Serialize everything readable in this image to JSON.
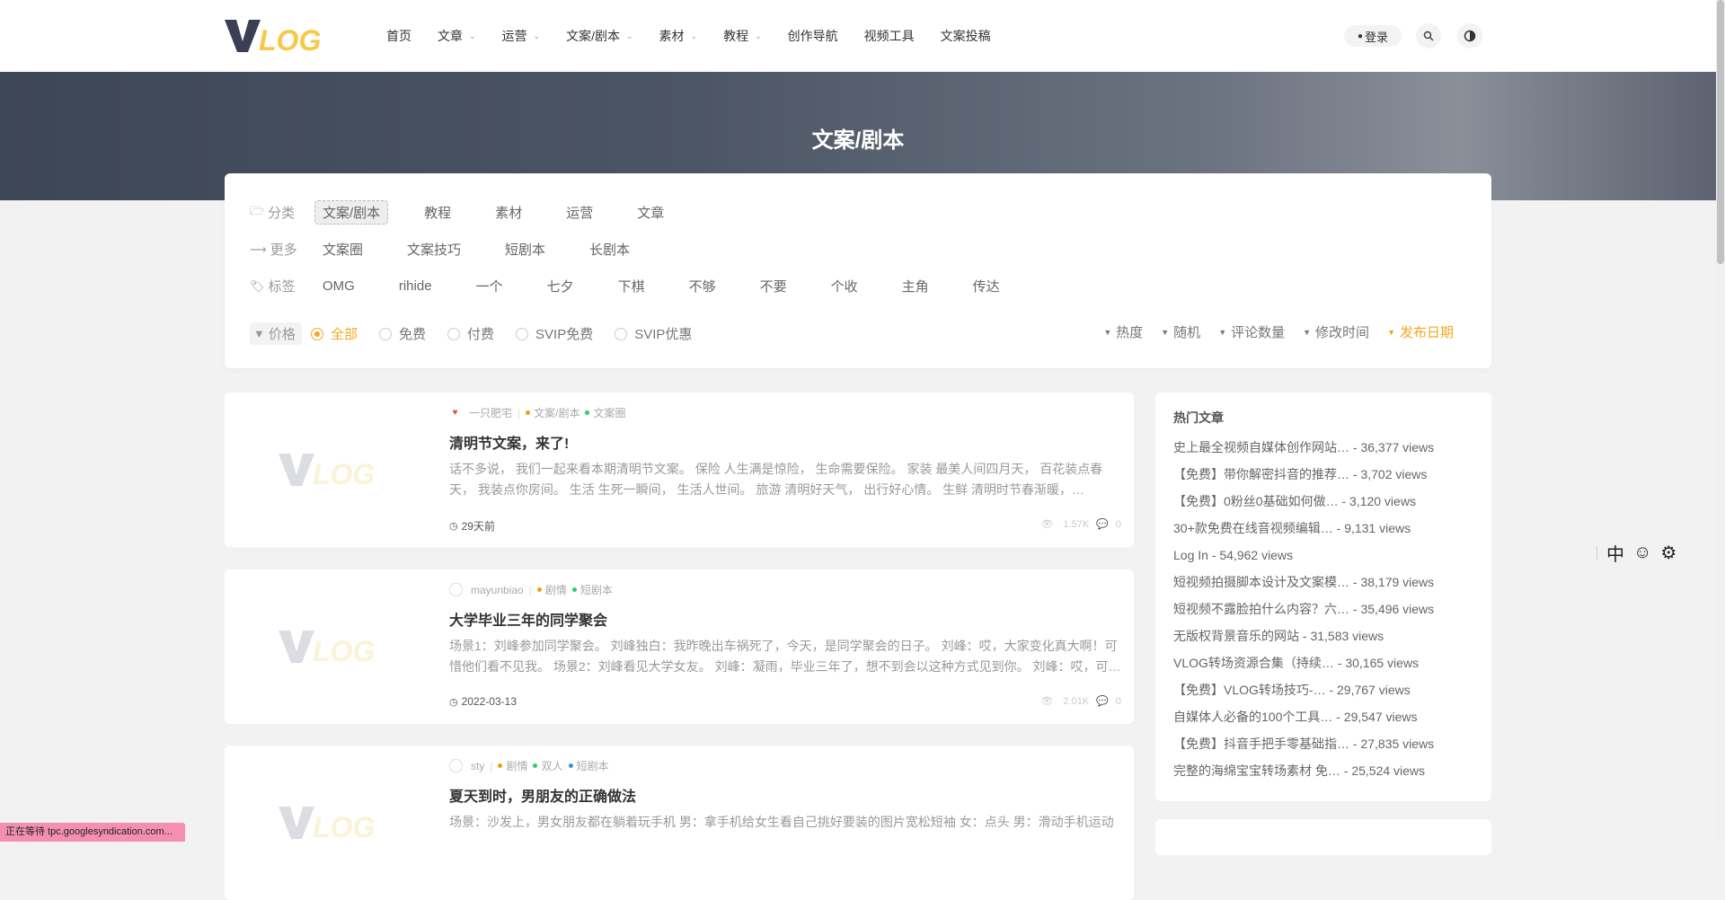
{
  "header": {
    "logo_text": "VLOG",
    "nav": [
      {
        "label": "首页",
        "dropdown": false
      },
      {
        "label": "文章",
        "dropdown": true
      },
      {
        "label": "运营",
        "dropdown": true
      },
      {
        "label": "文案/剧本",
        "dropdown": true
      },
      {
        "label": "素材",
        "dropdown": true
      },
      {
        "label": "教程",
        "dropdown": true
      },
      {
        "label": "创作导航",
        "dropdown": false
      },
      {
        "label": "视频工具",
        "dropdown": false
      },
      {
        "label": "文案投稿",
        "dropdown": false
      }
    ],
    "login_label": "登录"
  },
  "banner": {
    "title": "文案/剧本"
  },
  "filters": {
    "category": {
      "label": "分类",
      "items": [
        "文案/剧本",
        "教程",
        "素材",
        "运营",
        "文章"
      ],
      "active": "文案/剧本"
    },
    "more": {
      "label": "更多",
      "items": [
        "文案圈",
        "文案技巧",
        "短剧本",
        "长剧本"
      ]
    },
    "tags": {
      "label": "标签",
      "items": [
        "OMG",
        "rihide",
        "一个",
        "七夕",
        "下棋",
        "不够",
        "不要",
        "个收",
        "主角",
        "传达"
      ]
    },
    "price": {
      "label": "价格",
      "options": [
        "全部",
        "免费",
        "付费",
        "SVIP免费",
        "SVIP优惠"
      ],
      "selected": "全部"
    },
    "sort": {
      "options": [
        "热度",
        "随机",
        "评论数量",
        "修改时间",
        "发布日期"
      ],
      "active": "发布日期"
    }
  },
  "posts": [
    {
      "author": "一只肥宅",
      "cats": [
        "文案/剧本",
        "文案圈"
      ],
      "title": "清明节文案，来了!",
      "excerpt": "话不多说， 我们一起来看本期清明节文案。  保险 人生满是惊险， 生命需要保险。  家装 最美人间四月天， 百花装点春天， 我装点你房间。  生活 生死一瞬间， 生活人世间。  旅游 清明好天气， 出行好心情。  生鲜 清明时节春渐暖，…",
      "date": "29天前",
      "views": "1.57K",
      "comments": "0"
    },
    {
      "author": "mayunbiao",
      "cats": [
        "剧情",
        "短剧本"
      ],
      "title": "大学毕业三年的同学聚会",
      "excerpt": "场景1：刘峰参加同学聚会。 刘峰独白：我昨晚出车祸死了，今天，是同学聚会的日子。 刘峰：哎，大家变化真大啊！可惜他们看不见我。 场景2：刘峰看见大学女友。 刘峰：凝雨，毕业三年了，想不到会以这种方式见到你。 刘峰：哎，可…",
      "date": "2022-03-13",
      "views": "2.01K",
      "comments": "0"
    },
    {
      "author": "sty",
      "cats": [
        "剧情",
        "双人",
        "短剧本"
      ],
      "title": "夏天到时，男朋友的正确做法",
      "excerpt": "场景：沙发上，男女朋友都在躺着玩手机 男：拿手机给女生看自己挑好要装的图片宽松短袖 女：点头 男：滑动手机运动",
      "date": "",
      "views": "",
      "comments": ""
    }
  ],
  "sidebar": {
    "title": "热门文章",
    "items": [
      "史上最全视频自媒体创作网站… - 36,377 views",
      "【免费】带你解密抖音的推荐… - 3,702 views",
      "【免费】0粉丝0基础如何做… - 3,120 views",
      "30+款免费在线音视频编辑… - 9,131 views",
      "Log In - 54,962 views",
      "短视频拍摄脚本设计及文案模… - 38,179 views",
      "短视频不露脸拍什么内容？六… - 35,496 views",
      "无版权背景音乐的网站 - 31,583 views",
      "VLOG转场资源合集（持续… - 30,165 views",
      "【免费】VLOG转场技巧-… - 29,767 views",
      "自媒体人必备的100个工具… - 29,547 views",
      "【免费】抖音手把手零基础指… - 27,835 views",
      "完整的海绵宝宝转场素材 免… - 25,524 views"
    ]
  },
  "float_tools": {
    "lang": "中"
  },
  "statusbar": {
    "text": "正在等待 tpc.googlesyndication.com..."
  },
  "colors": {
    "accent": "#f5a623",
    "logo_v": "#3b3f56",
    "logo_log": "#f7c948",
    "status_bg": "#f48fb1"
  }
}
